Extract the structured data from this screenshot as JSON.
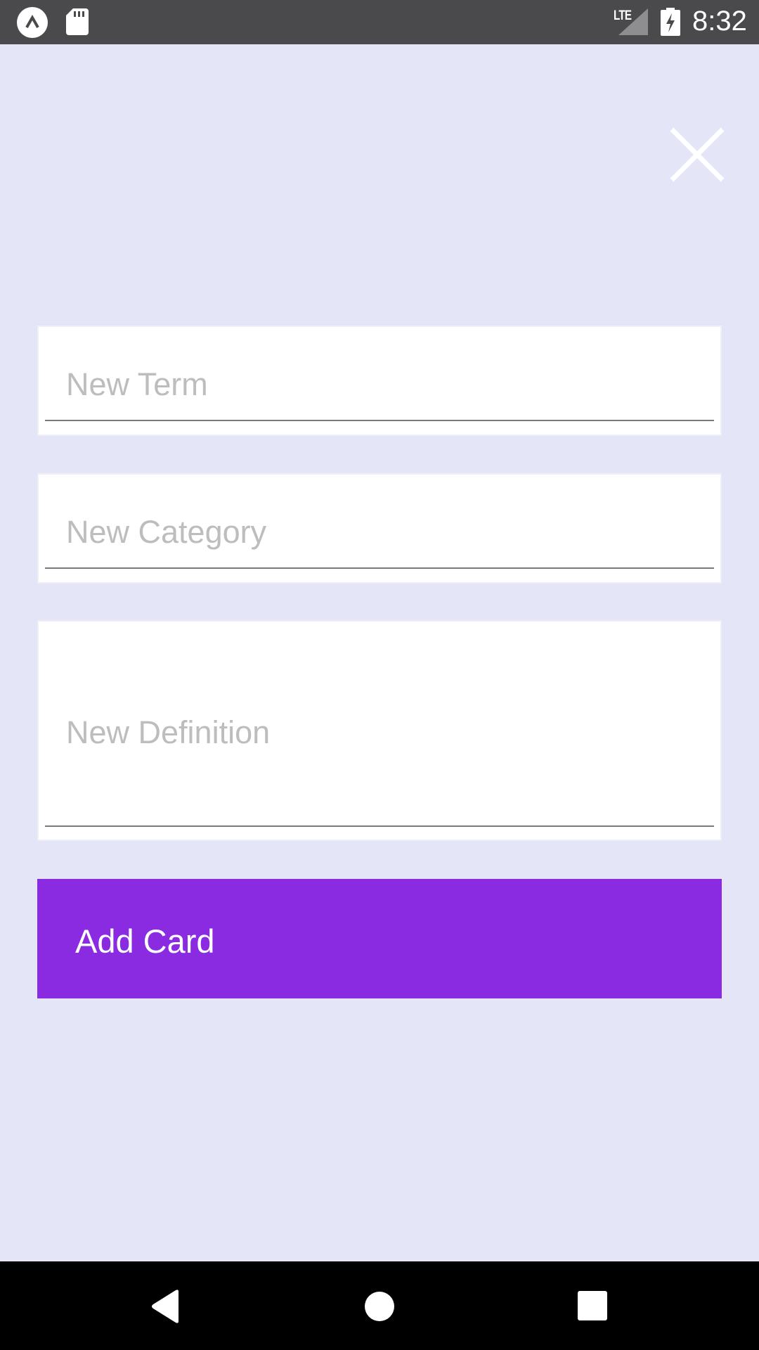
{
  "status_bar": {
    "network_label": "LTE",
    "time": "8:32",
    "icons": [
      "app-notification-icon",
      "sd-card-icon",
      "signal-icon",
      "battery-charging-icon"
    ]
  },
  "header": {
    "close_icon": "close-icon"
  },
  "form": {
    "term": {
      "placeholder": "New Term",
      "value": ""
    },
    "category": {
      "placeholder": "New Category",
      "value": ""
    },
    "definition": {
      "placeholder": "New Definition",
      "value": ""
    },
    "submit_label": "Add Card"
  },
  "nav_bar": {
    "icons": [
      "back-icon",
      "home-icon",
      "recents-icon"
    ]
  },
  "colors": {
    "background": "#E5E5F8",
    "accent": "#8A2BE2",
    "status_bar": "#4A4A4D",
    "placeholder": "#BDBDBD"
  }
}
